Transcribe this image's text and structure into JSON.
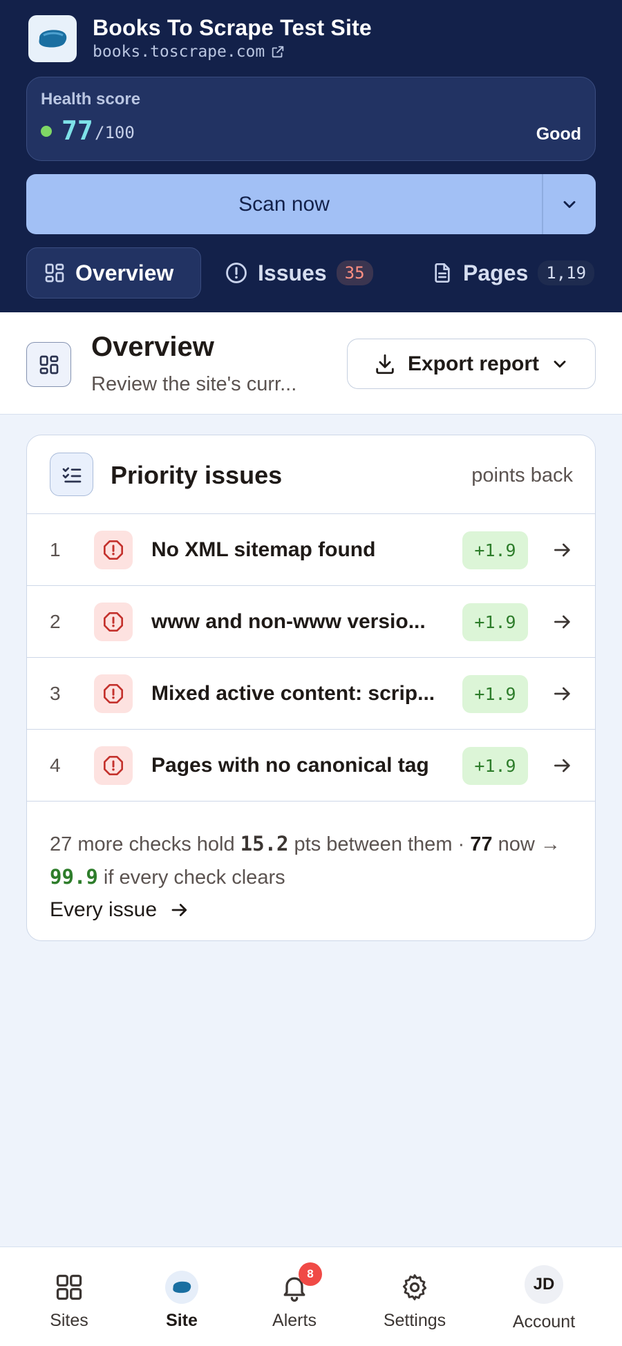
{
  "site": {
    "title": "Books To Scrape Test Site",
    "url": "books.toscrape.com"
  },
  "health": {
    "label": "Health score",
    "score": "77",
    "max": "/100",
    "status": "Good",
    "status_color": "#7fd765"
  },
  "scan": {
    "label": "Scan now"
  },
  "tabs": [
    {
      "label": "Overview",
      "icon": "grid-icon"
    },
    {
      "label": "Issues",
      "icon": "alert-circle-icon",
      "badge": "35"
    },
    {
      "label": "Pages",
      "icon": "document-icon",
      "badge": "1,19"
    }
  ],
  "section": {
    "title": "Overview",
    "subtitle": "Review the site's curr...",
    "export_label": "Export report"
  },
  "priority": {
    "title": "Priority issues",
    "aside": "points back",
    "issues": [
      {
        "num": "1",
        "text": "No XML sitemap found",
        "points": "+1.9"
      },
      {
        "num": "2",
        "text": "www and non-www versio...",
        "points": "+1.9"
      },
      {
        "num": "3",
        "text": "Mixed active content: scrip...",
        "points": "+1.9"
      },
      {
        "num": "4",
        "text": "Pages with no canonical tag",
        "points": "+1.9"
      }
    ],
    "summary": {
      "part1": "27 more checks hold ",
      "pts": "15.2",
      "part2": " pts between them · ",
      "now": "77",
      "part3": " now → ",
      "target": "99.9",
      "part4": " if every check clears"
    },
    "every_issue_link": "Every issue"
  },
  "nav": {
    "items": [
      {
        "label": "Sites",
        "icon": "grid-icon"
      },
      {
        "label": "Site",
        "icon": "site-favicon-icon"
      },
      {
        "label": "Alerts",
        "icon": "bell-icon",
        "badge": "8"
      },
      {
        "label": "Settings",
        "icon": "gear-icon"
      },
      {
        "label": "Account",
        "avatar": "JD"
      }
    ]
  },
  "colors": {
    "header_bg": "#13214a",
    "accent_button": "#a2c0f5",
    "page_bg": "#eef3fb",
    "danger": "#f04a46",
    "success": "#2e7d2b"
  }
}
